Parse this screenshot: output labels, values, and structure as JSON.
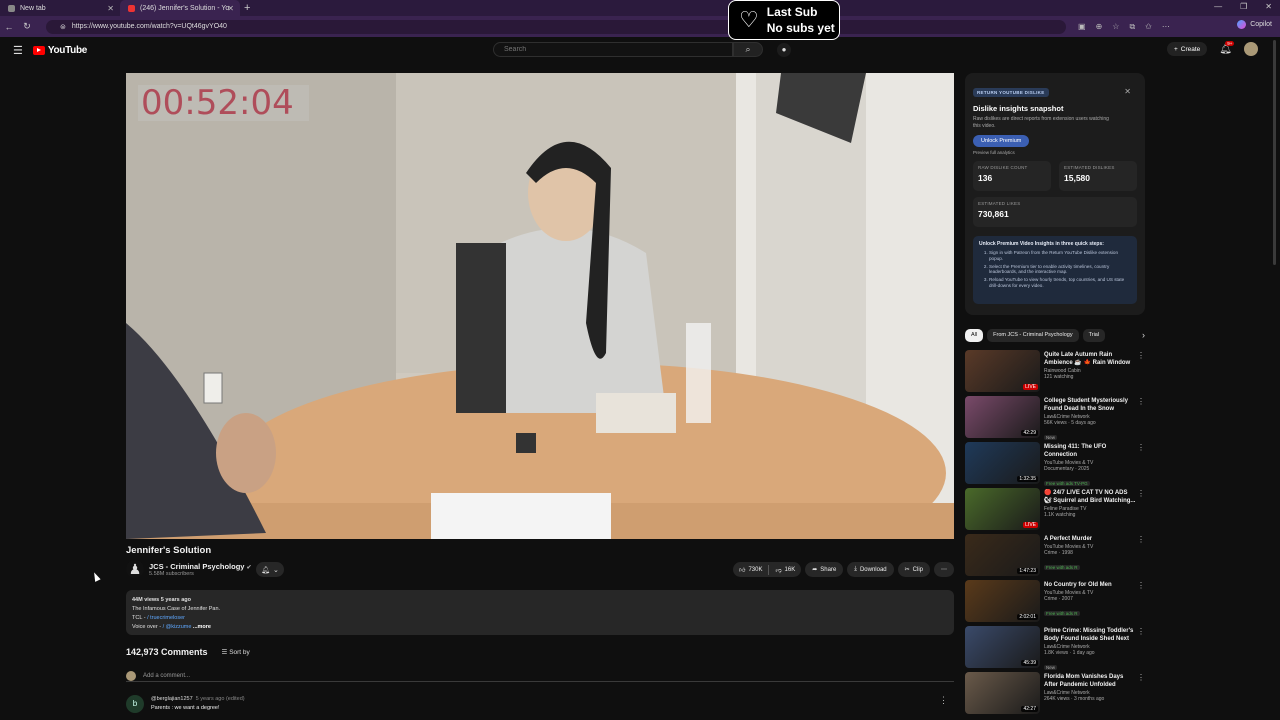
{
  "browser": {
    "tabs": [
      {
        "label": "New tab"
      },
      {
        "label": "(246) Jennifer's Solution - Yo"
      }
    ],
    "url": "https://www.youtube.com/watch?v=UQt46gvYO40",
    "copilot_label": "Copilot"
  },
  "overlay": {
    "line1": "Last Sub",
    "line2": "No subs yet"
  },
  "youtube": {
    "logo_text": "YouTube",
    "search_placeholder": "Search",
    "create_label": "Create",
    "notif_count": "9+"
  },
  "video": {
    "timestamp": "00:52:04",
    "title": "Jennifer's Solution",
    "channel_name": "JCS - Criminal Psychology",
    "subscribers": "5.58M subscribers",
    "likes": "730K",
    "dislikes": "16K",
    "share_label": "Share",
    "download_label": "Download",
    "clip_label": "Clip"
  },
  "description": {
    "meta": "44M views  5 years ago",
    "line1": "The Infamous Case of Jennifer Pan.",
    "tcl_prefix": "TCL - ",
    "tcl_handle": "/ truecrimeloser",
    "vo_prefix": "Voice over - ",
    "vo_handle": "/ @kizzume",
    "more": "...more"
  },
  "comments": {
    "count": "142,973 Comments",
    "sort_label": "Sort by",
    "add_placeholder": "Add a comment...",
    "first": {
      "avatar_letter": "b",
      "user": "@berglajian1257",
      "time": "5 years ago (edited)",
      "text": "Parents : we want a degree!"
    }
  },
  "rdy": {
    "tag": "RETURN YOUTUBE DISLIKE",
    "title": "Dislike insights snapshot",
    "desc": "Raw dislikes are direct reports from extension users watching this video.",
    "unlock_btn": "Unlock Premium",
    "preview": "Preview full analytics",
    "raw_label": "RAW DISLIKE COUNT",
    "raw_value": "136",
    "est_dislikes_label": "ESTIMATED DISLIKES",
    "est_dislikes_value": "15,580",
    "est_likes_label": "ESTIMATED LIKES",
    "est_likes_value": "730,861",
    "steps_title": "Unlock Premium Video Insights in three quick steps:",
    "steps": [
      "Sign in with Patreon from the Return YouTube Dislike extension popup.",
      "Select the Premium tier to enable activity timelines, country leaderboards, and the interactive map.",
      "Reload YouTube to view hourly trends, top countries, and US state drill-downs for every video."
    ]
  },
  "chips": [
    "All",
    "From JCS - Criminal Psychology",
    "Trial"
  ],
  "recommendations": [
    {
      "title": "Quite Late Autumn Rain Ambience ☕ 🍁 Rain Window ...",
      "channel": "Rainwood Cabin",
      "meta": "121 watching",
      "badge": "",
      "duration": "LIVE",
      "live": true,
      "color": "#5a3a28"
    },
    {
      "title": "College Student Mysteriously Found Dead In the Snow",
      "channel": "Law&Crime Network",
      "meta": "56K views · 5 days ago",
      "badge": "New",
      "duration": "42:29",
      "live": false,
      "color": "#7a4a6a"
    },
    {
      "title": "Missing 411: The UFO Connection",
      "channel": "YouTube Movies & TV",
      "meta": "Documentary · 2025",
      "badge": "Free with ads  TV-PG",
      "duration": "1:32:35",
      "live": false,
      "color": "#1f3a5a"
    },
    {
      "title": "🔴 24/7 LIVE CAT TV NO ADS 🐿 Squirrel and Bird Watching...",
      "channel": "Feline Paradise TV",
      "meta": "1.1K watching",
      "badge": "",
      "duration": "LIVE",
      "live": true,
      "color": "#4a6a2a"
    },
    {
      "title": "A Perfect Murder",
      "channel": "YouTube Movies & TV",
      "meta": "Crime · 1998",
      "badge": "Free with ads  R",
      "duration": "1:47:23",
      "live": false,
      "color": "#3a2a1a"
    },
    {
      "title": "No Country for Old Men",
      "channel": "YouTube Movies & TV",
      "meta": "Crime · 2007",
      "badge": "Free with ads  R",
      "duration": "2:02:01",
      "live": false,
      "color": "#5a3a1a"
    },
    {
      "title": "Prime Crime: Missing Toddler's Body Found Inside Shed Next t...",
      "channel": "Law&Crime Network",
      "meta": "1.8K views · 1 day ago",
      "badge": "New",
      "duration": "45:39",
      "live": false,
      "color": "#3a4a6a"
    },
    {
      "title": "Florida Mom Vanishes Days After Pandemic Unfolded",
      "channel": "Law&Crime Network",
      "meta": "264K views · 3 months ago",
      "badge": "",
      "duration": "42:27",
      "live": false,
      "color": "#6a5a4a"
    }
  ]
}
